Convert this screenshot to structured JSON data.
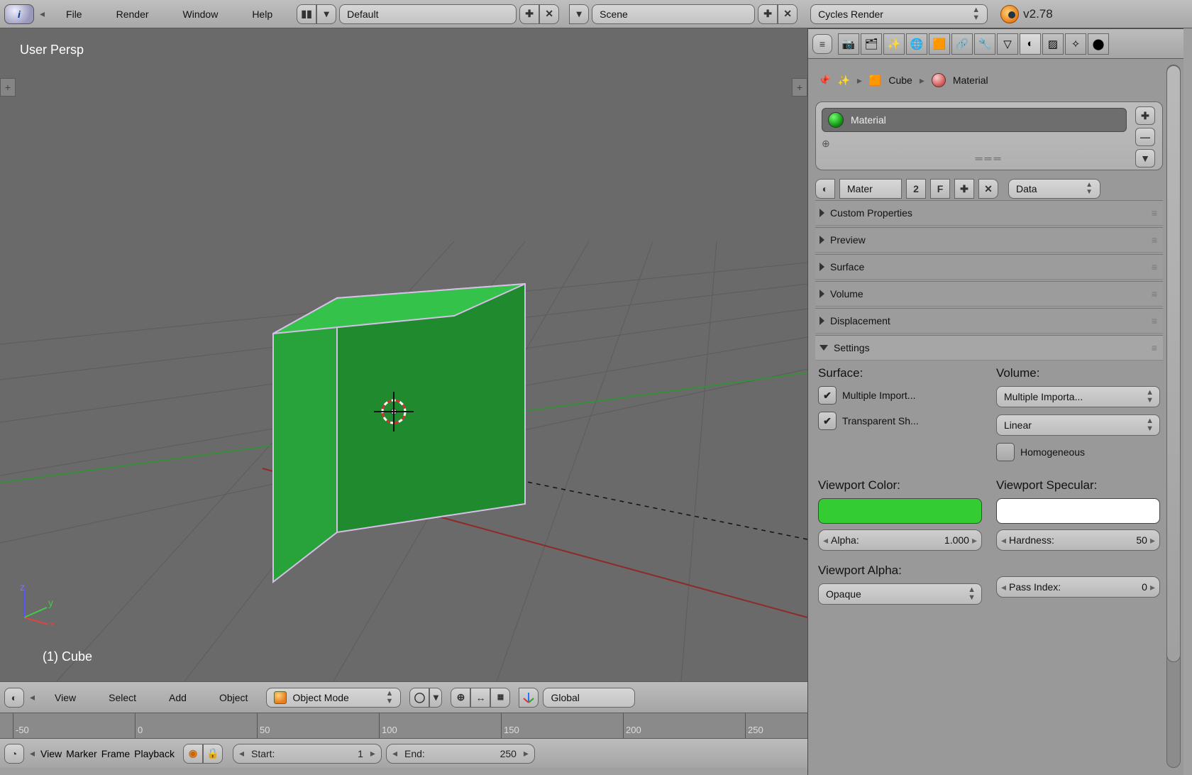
{
  "topbar": {
    "menus": [
      "File",
      "Render",
      "Window",
      "Help"
    ],
    "layout_field": "Default",
    "scene_field": "Scene",
    "engine_field": "Cycles Render",
    "version": "v2.78"
  },
  "viewport": {
    "perspective": "User Persp",
    "object_label": "(1) Cube",
    "header": {
      "menus": [
        "View",
        "Select",
        "Add",
        "Object"
      ],
      "mode": "Object Mode",
      "orientation": "Global"
    }
  },
  "timeline": {
    "ticks": [
      "-50",
      "0",
      "50",
      "100",
      "150",
      "200",
      "250"
    ],
    "header": {
      "menus": [
        "View",
        "Marker",
        "Frame",
        "Playback"
      ],
      "start_label": "Start:",
      "start_value": "1",
      "end_label": "End:",
      "end_value": "250"
    }
  },
  "properties": {
    "breadcrumb": {
      "object": "Cube",
      "material": "Material"
    },
    "material_list": {
      "slot0": "Material"
    },
    "name_row": {
      "name": "Mater",
      "users": "2",
      "fake": "F",
      "link": "Data"
    },
    "panels": {
      "custom_properties": "Custom Properties",
      "preview": "Preview",
      "surface": "Surface",
      "volume": "Volume",
      "displacement": "Displacement",
      "settings": "Settings"
    },
    "settings": {
      "surface_label": "Surface:",
      "volume_label": "Volume:",
      "mis": "Multiple Import...",
      "tshadow": "Transparent Sh...",
      "vol_sampling": "Multiple Importa...",
      "vol_interp": "Linear",
      "homogeneous": "Homogeneous",
      "viewport_color_label": "Viewport Color:",
      "viewport_color": "#33cc33",
      "viewport_specular_label": "Viewport Specular:",
      "viewport_specular": "#ffffff",
      "alpha_label": "Alpha:",
      "alpha_value": "1.000",
      "hardness_label": "Hardness:",
      "hardness_value": "50",
      "viewport_alpha_label": "Viewport Alpha:",
      "viewport_alpha_value": "Opaque",
      "pass_index_label": "Pass Index:",
      "pass_index_value": "0"
    }
  }
}
